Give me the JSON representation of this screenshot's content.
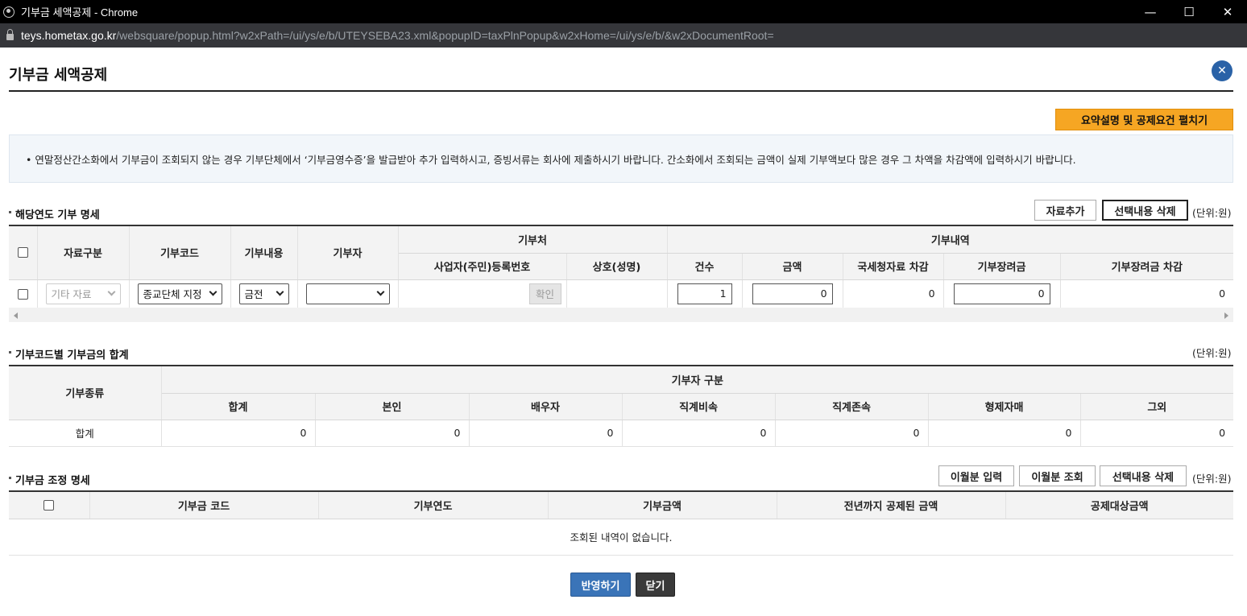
{
  "window": {
    "title": "기부금 세액공제 - Chrome",
    "minimize": "—",
    "maximize": "☐",
    "close": "✕"
  },
  "address": {
    "host": "teys.hometax.go.kr",
    "path": "/websquare/popup.html?w2xPath=/ui/ys/e/b/UTEYSEBA23.xml&popupID=taxPlnPopup&w2xHome=/ui/ys/e/b/&w2xDocumentRoot="
  },
  "page": {
    "title": "기부금 세액공제",
    "close_icon": "✕",
    "summary_button": "요약설명 및 공제요건 펼치기",
    "notice": "• 연말정산간소화에서 기부금이 조회되지 않는 경우 기부단체에서 ‘기부금영수증’을 발급받아 추가 입력하시고, 증빙서류는 회사에 제출하시기 바랍니다. 간소화에서 조회되는 금액이 실제 기부액보다 많은 경우 그 차액을 차감액에 입력하시기 바랍니다."
  },
  "section1": {
    "title": "해당연도 기부 명세",
    "add_button": "자료추가",
    "delete_button": "선택내용 삭제",
    "unit": "(단위:원)",
    "headers": {
      "data_type": "자료구분",
      "code": "기부코드",
      "content": "기부내용",
      "donor": "기부자",
      "place": "기부처",
      "reg_no": "사업자(주민)등록번호",
      "name": "상호(성명)",
      "details": "기부내역",
      "count": "건수",
      "amount": "금액",
      "nts_deduct": "국세청자료 차감",
      "incentive": "기부장려금",
      "incentive_deduct": "기부장려금 차감"
    },
    "row": {
      "data_type": "기타 자료",
      "code": "종교단체 지정",
      "content": "금전",
      "donor": "",
      "reg_no": "",
      "confirm": "확인",
      "name": "",
      "count": "1",
      "amount": "0",
      "nts_deduct": "0",
      "incentive": "0",
      "incentive_deduct": "0"
    }
  },
  "section2": {
    "title": "기부코드별 기부금의 합계",
    "unit": "(단위:원)",
    "headers": {
      "type": "기부종류",
      "donor_group": "기부자 구분",
      "total": "합계",
      "self": "본인",
      "spouse": "배우자",
      "desc": "직계비속",
      "asc": "직계존속",
      "sibling": "형제자매",
      "other": "그외"
    },
    "row": {
      "label": "합계",
      "total": "0",
      "self": "0",
      "spouse": "0",
      "desc": "0",
      "asc": "0",
      "sibling": "0",
      "other": "0"
    }
  },
  "section3": {
    "title": "기부금 조정 명세",
    "carry_input_button": "이월분 입력",
    "carry_query_button": "이월분 조회",
    "delete_button": "선택내용 삭제",
    "unit": "(단위:원)",
    "headers": {
      "code": "기부금 코드",
      "year": "기부연도",
      "amount": "기부금액",
      "prev_deducted": "전년까지 공제된 금액",
      "target": "공제대상금액"
    },
    "empty": "조회된 내역이 없습니다."
  },
  "footer": {
    "apply_button": "반영하기",
    "close_button": "닫기"
  },
  "colors": {
    "accent": "#2a62a7",
    "orange": "#f6a623",
    "dark_button": "#3a3a3a"
  }
}
